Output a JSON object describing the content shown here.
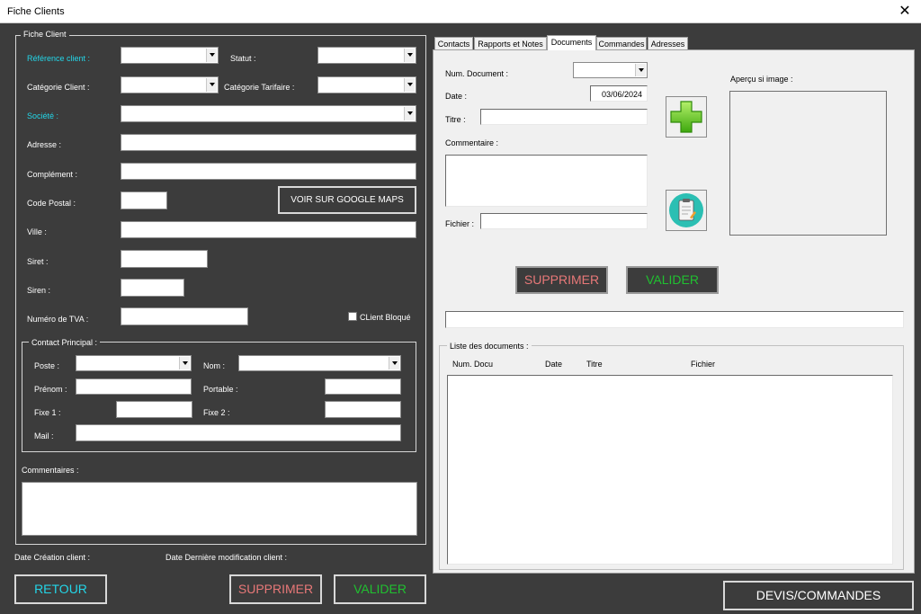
{
  "window": {
    "title": "Fiche Clients",
    "close": "✕"
  },
  "fiche": {
    "legend": "Fiche Client",
    "reference_label": "Référence client :",
    "statut_label": "Statut :",
    "categorie_label": "Catégorie Client :",
    "categorie_tarif_label": "Catégorie Tarifaire :",
    "societe_label": "Société :",
    "adresse_label": "Adresse :",
    "complement_label": "Complément :",
    "code_postal_label": "Code Postal :",
    "maps_button": "VOIR SUR GOOGLE MAPS",
    "ville_label": "Ville :",
    "siret_label": "Siret :",
    "siren_label": "Siren :",
    "tva_label": "Numéro de TVA :",
    "client_bloque_label": "CLient Bloqué"
  },
  "contact": {
    "legend": "Contact Principal :",
    "poste_label": "Poste :",
    "nom_label": "Nom :",
    "prenom_label": "Prénom :",
    "portable_label": "Portable :",
    "fixe1_label": "Fixe 1 :",
    "fixe2_label": "Fixe 2 :",
    "mail_label": "Mail :"
  },
  "commentaires_label": "Commentaires :",
  "footer": {
    "date_creation_label": "Date Création client :",
    "date_modif_label": "Date Dernière modification client :",
    "retour": "RETOUR",
    "supprimer": "SUPPRIMER",
    "valider": "VALIDER",
    "devis": "DEVIS/COMMANDES"
  },
  "tabs": [
    "Contacts",
    "Rapports et Notes",
    "Documents",
    "Commandes",
    "Adresses"
  ],
  "documents": {
    "num_label": "Num. Document :",
    "date_label": "Date :",
    "date_value": "03/06/2024",
    "titre_label": "Titre :",
    "commentaire_label": "Commentaire :",
    "fichier_label": "Fichier :",
    "apercu_label": "Aperçu si image :",
    "supprimer": "SUPPRIMER",
    "valider": "VALIDER",
    "liste_legend": "Liste des documents :",
    "columns": [
      "Num. Docu",
      "Date",
      "Titre",
      "Fichier"
    ]
  },
  "colors": {
    "background": "#3c3c3c",
    "cyan": "#23d6e8",
    "red_button": "#e87878",
    "green_button": "#20c030",
    "panel": "#f0f0f0"
  },
  "icons": {
    "add": "green-plus-icon",
    "clipboard": "clipboard-icon"
  }
}
